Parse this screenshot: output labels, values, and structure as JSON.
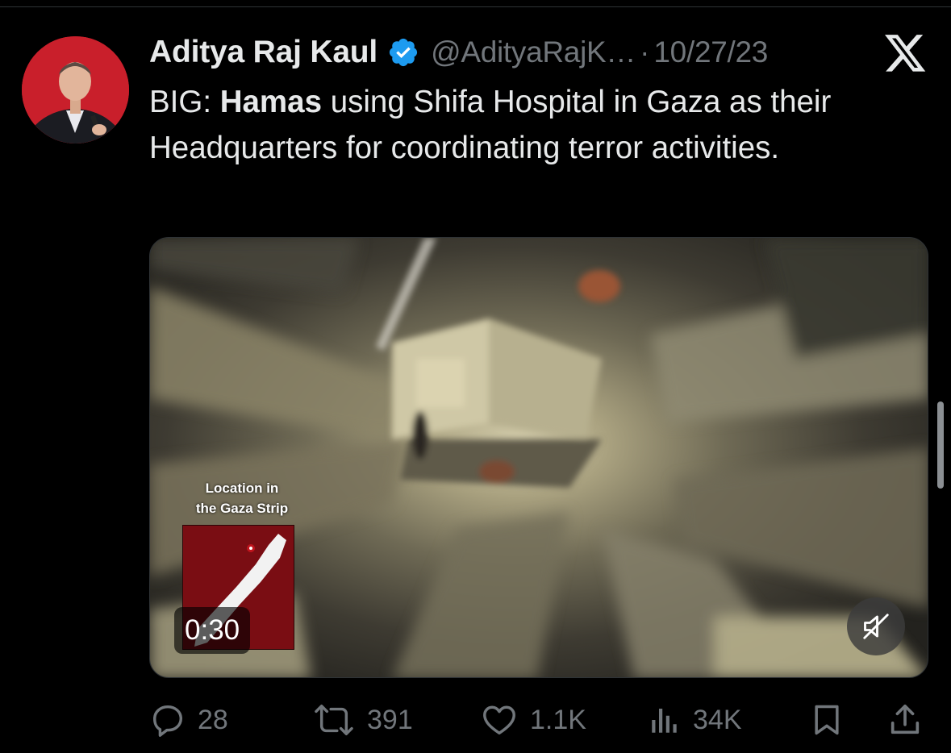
{
  "author": {
    "display_name": "Aditya Raj Kaul",
    "handle": "@AdityaRajK…",
    "separator": "·",
    "date": "10/27/23",
    "verified": true
  },
  "tweet": {
    "prefix": "BIG: ",
    "bold": "Hamas",
    "rest": " using Shifa Hospital in Gaza as their Headquarters for coordinating terror activities."
  },
  "media": {
    "caption_line1": "Location in",
    "caption_line2": "the Gaza Strip",
    "duration": "0:30",
    "muted": true
  },
  "actions": {
    "replies": "28",
    "reposts": "391",
    "likes": "1.1K",
    "views": "34K"
  },
  "colors": {
    "background": "#000000",
    "text": "#e7e9ea",
    "secondary": "#71767b",
    "verified_blue": "#1d9bf0",
    "avatar_bg": "#c91f2b",
    "map_red": "#7a0d13"
  },
  "icons": {
    "reply": "reply-icon",
    "repost": "repost-icon",
    "like": "like-icon",
    "views": "views-icon",
    "bookmark": "bookmark-icon",
    "share": "share-icon",
    "mute": "mute-icon",
    "brand": "x-logo-icon",
    "verified": "verified-badge-icon"
  }
}
